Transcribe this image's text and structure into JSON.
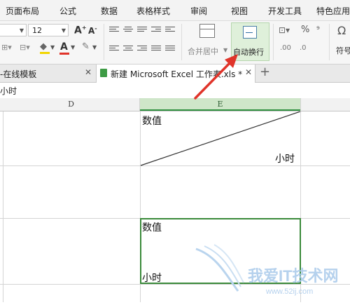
{
  "menu": {
    "items": [
      "页面布局",
      "公式",
      "数据",
      "表格样式",
      "审阅",
      "视图",
      "开发工具",
      "特色应用"
    ]
  },
  "ribbon": {
    "font_size": "12",
    "merge_center_label": "合并居中",
    "wrap_text_label": "自动换行",
    "symbol_label": "符号",
    "percent_icon_text": "%"
  },
  "tabs": {
    "first_tab_title": "-在线模板",
    "active_tab_title": "新建 Microsoft Excel 工作表.xls *"
  },
  "formula_bar": {
    "value": "小时"
  },
  "columns": {
    "d": "D",
    "e": "E"
  },
  "cells": {
    "e1_top": "数值",
    "e1_bottom": "小时",
    "e3_top": "数值",
    "e3_bottom": "小时"
  },
  "watermark": {
    "text": "我爱IT技术网",
    "url": "www.52ij.com"
  },
  "colors": {
    "accent_green": "#3a8a3a",
    "annotation_red": "#e0342a"
  }
}
